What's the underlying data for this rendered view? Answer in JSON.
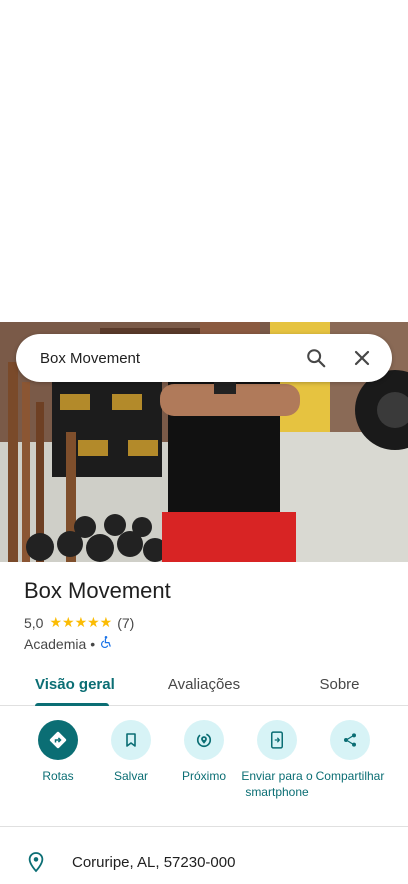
{
  "search": {
    "query": "Box Movement"
  },
  "place": {
    "name": "Box Movement",
    "rating": "5,0",
    "stars": "★★★★★",
    "review_count": "(7)",
    "category": "Academia",
    "separator": "•"
  },
  "tabs": [
    {
      "label": "Visão geral",
      "active": true
    },
    {
      "label": "Avaliações",
      "active": false
    },
    {
      "label": "Sobre",
      "active": false
    }
  ],
  "actions": [
    {
      "label": "Rotas",
      "icon": "directions-icon"
    },
    {
      "label": "Salvar",
      "icon": "bookmark-icon"
    },
    {
      "label": "Próximo",
      "icon": "nearby-icon"
    },
    {
      "label": "Enviar para o smartphone",
      "icon": "send-to-phone-icon"
    },
    {
      "label": "Compartilhar",
      "icon": "share-icon"
    }
  ],
  "address": {
    "text": "Coruripe, AL, 57230-000"
  },
  "colors": {
    "accent": "#0b6e74",
    "chip_bg": "#d7f3f6",
    "star": "#fbbc04"
  }
}
